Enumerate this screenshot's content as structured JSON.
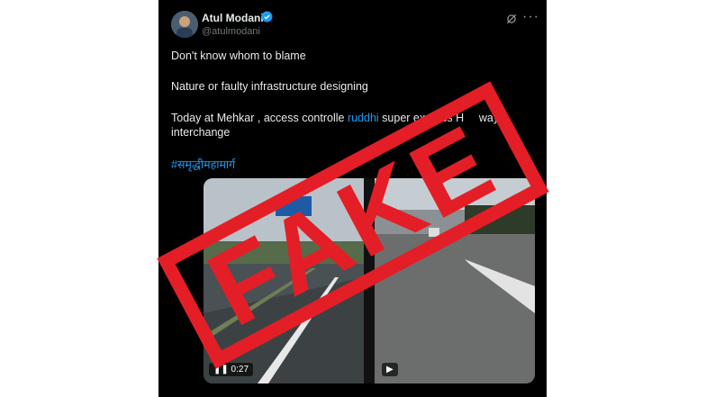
{
  "tweet": {
    "author_name": "Atul Modani",
    "handle": "@atulmodani",
    "lines": [
      "Don't know whom to blame",
      "Nature or faulty infrastructure designing"
    ],
    "line3_before": "Today at Mehkar , access controlle",
    "line3_link": "ruddhi",
    "line3_after": " super express H",
    "line3_tail": "way",
    "line4": "interchange",
    "hashtag": "#समृद्धीमहामार्ग"
  },
  "media": {
    "video1_time": "0:27"
  },
  "overlay": {
    "stamp_text": "FAKE",
    "stamp_color": "#e41e26"
  },
  "icons": [
    "verified-badge-icon",
    "grok-icon",
    "more-icon",
    "pause-icon",
    "play-icon"
  ],
  "colors": {
    "background": "#000000",
    "text": "#e7e9ea",
    "muted": "#71767b",
    "link": "#1d9bf0"
  }
}
